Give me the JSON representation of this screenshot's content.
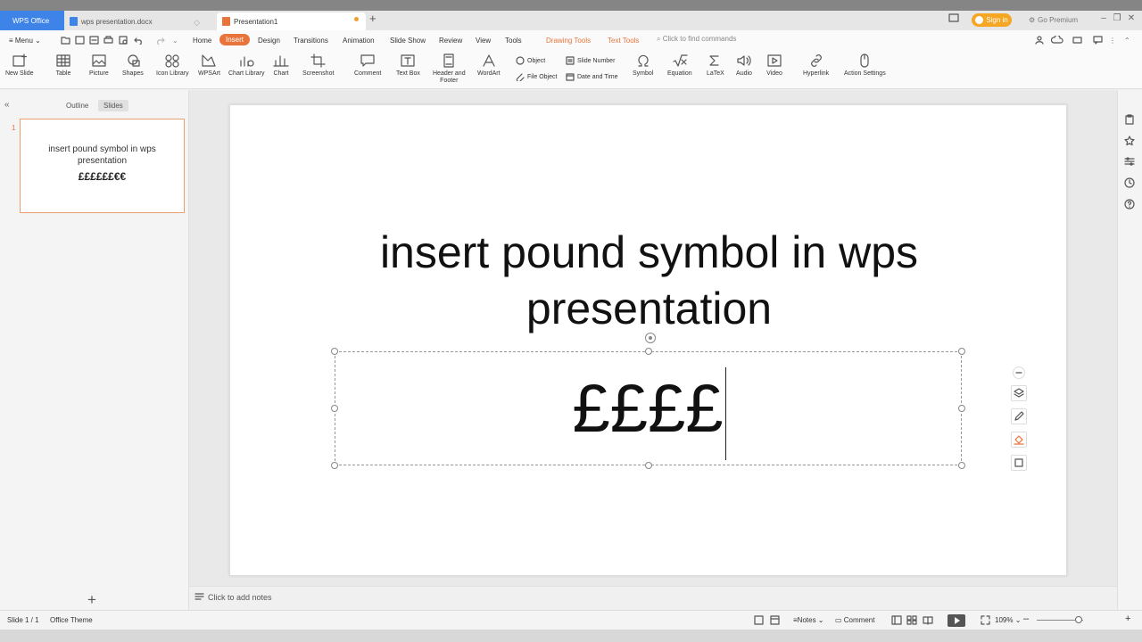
{
  "tabs": {
    "wps_office": "WPS Office",
    "doc": "wps presentation.docx",
    "presentation": "Presentation1"
  },
  "titlebar": {
    "sign_in": "Sign in",
    "go_premium": "Go Premium"
  },
  "menu": {
    "menu_label": "Menu",
    "items": [
      "Home",
      "Insert",
      "Design",
      "Transitions",
      "Animation",
      "Slide Show",
      "Review",
      "View",
      "Tools",
      "Drawing Tools",
      "Text Tools"
    ],
    "find_placeholder": "Click to find commands"
  },
  "ribbon": {
    "new_slide": "New Slide",
    "table": "Table",
    "picture": "Picture",
    "shapes": "Shapes",
    "icon_library": "Icon Library",
    "wpsart": "WPSArt",
    "chart_library": "Chart Library",
    "chart": "Chart",
    "screenshot": "Screenshot",
    "comment": "Comment",
    "text_box": "Text Box",
    "header_footer_1": "Header and",
    "header_footer_2": "Footer",
    "wordart": "WordArt",
    "object": "Object",
    "file_object": "File Object",
    "slide_number": "Slide Number",
    "date_time": "Date and Time",
    "symbol": "Symbol",
    "equation": "Equation",
    "latex": "LaTeX",
    "audio": "Audio",
    "video": "Video",
    "hyperlink": "Hyperlink",
    "action_settings": "Action Settings"
  },
  "panel": {
    "outline_tab": "Outline",
    "slides_tab": "Slides",
    "thumb_number": "1",
    "thumb_title": "insert pound symbol in wps presentation",
    "thumb_subtitle": "££££££€€"
  },
  "slide": {
    "title_line1": "insert pound symbol in wps",
    "title_line2": "presentation",
    "body_text": "££££"
  },
  "notes": {
    "placeholder": "Click to add notes"
  },
  "status": {
    "slide_count": "Slide 1 / 1",
    "theme": "Office Theme",
    "notes_btn": "Notes",
    "comment_btn": "Comment",
    "zoom": "109%"
  }
}
